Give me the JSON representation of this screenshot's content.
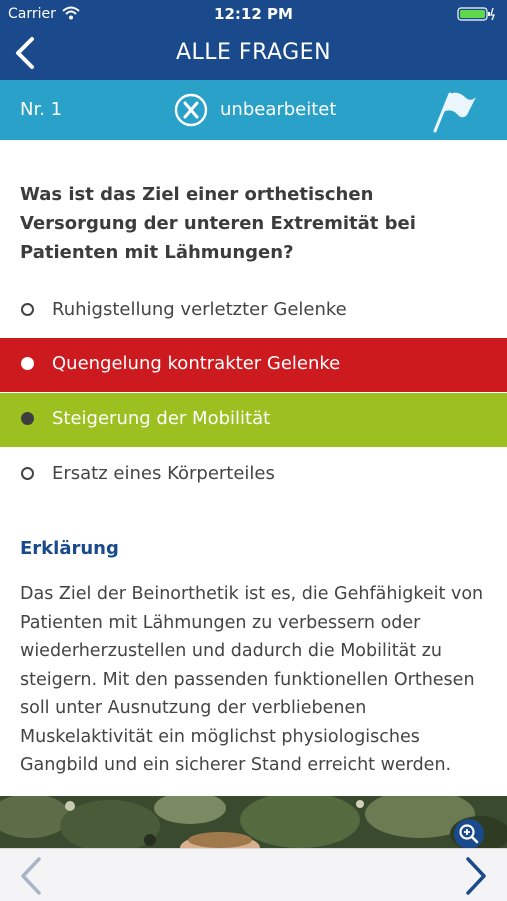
{
  "status_bar": {
    "carrier": "Carrier",
    "time": "12:12 PM",
    "icons": [
      "wifi-icon",
      "battery-icon"
    ]
  },
  "nav": {
    "title": "ALLE FRAGEN",
    "back_icon": "chevron-left-icon"
  },
  "question_bar": {
    "number_label": "Nr. 1",
    "status_icon": "x-circle-icon",
    "status_label": "unbearbeitet",
    "flag_icon": "flag-icon"
  },
  "question": {
    "text": "Was ist das Ziel einer orthetischen Versorgung der unteren Extremität bei Patienten mit Lähmungen?"
  },
  "answers": [
    {
      "label": "Ruhigstellung verletzter Gelenke",
      "state": "neutral"
    },
    {
      "label": "Quengelung kontrakter Gelenke",
      "state": "wrong-selected"
    },
    {
      "label": "Steigerung der Mobilität",
      "state": "correct"
    },
    {
      "label": "Ersatz eines Körperteiles",
      "state": "neutral"
    }
  ],
  "explanation": {
    "heading": "Erklärung",
    "text": "Das Ziel der Beinorthetik ist es, die Gehfähigkeit von Patienten mit Lähmungen zu verbessern oder wiederherzustellen und dadurch die Mobilität zu steigern. Mit den passenden funktionellen Orthesen soll unter Ausnutzung der verbliebenen Muskelaktivität ein möglichst physiologisches Gangbild und ein sicherer Stand erreicht werden."
  },
  "image": {
    "zoom_icon": "zoom-in-icon"
  },
  "bottom_nav": {
    "prev_icon": "chevron-left-icon",
    "next_icon": "chevron-right-icon"
  },
  "colors": {
    "primary": "#1a4a8c",
    "secondary": "#2aa1c8",
    "wrong": "#cc1a1f",
    "correct": "#9bc020"
  }
}
